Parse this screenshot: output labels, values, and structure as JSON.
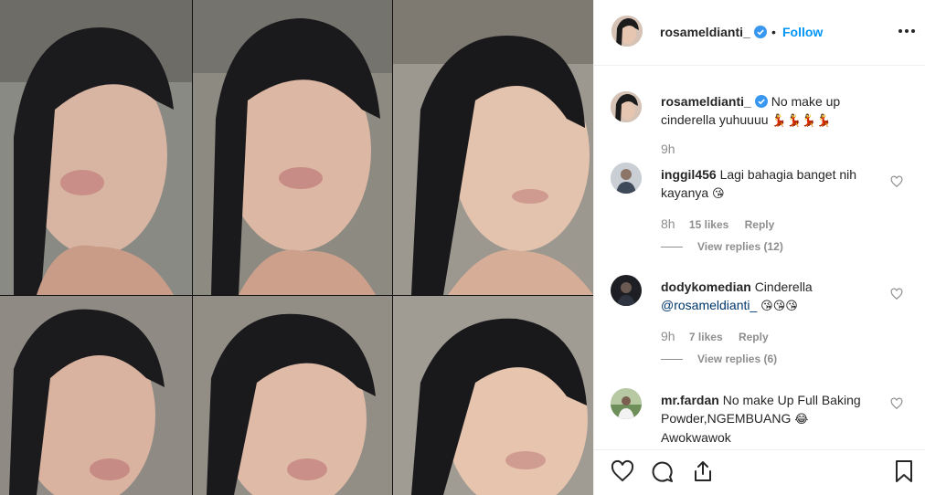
{
  "post": {
    "username": "rosameldianti_",
    "verified": true,
    "separator": "•",
    "follow_label": "Follow",
    "caption_text": "No make up cinderella yuhuuuu",
    "caption_emoji": "💃💃💃💃",
    "caption_time": "9h"
  },
  "comments": [
    {
      "username": "inggil456",
      "text": "Lagi bahagia banget nih kayanya",
      "emoji": "😘",
      "time": "8h",
      "likes": "15 likes",
      "reply": "Reply",
      "view_replies": "View replies (12)"
    },
    {
      "username": "dodykomedian",
      "text": "Cinderella",
      "mention": "@rosameldianti_",
      "emoji": "😘😘😘",
      "time": "9h",
      "likes": "7 likes",
      "reply": "Reply",
      "view_replies": "View replies (6)"
    },
    {
      "username": "mr.fardan",
      "text": "No make Up Full Baking Powder,NGEMBUANG",
      "emoji": "😂",
      "text2": "Awokwawok"
    }
  ],
  "icons": {
    "more": "more-options-icon",
    "like": "heart-icon",
    "comment": "comment-icon",
    "share": "share-icon",
    "save": "bookmark-icon"
  },
  "colors": {
    "link": "#0095f6",
    "muted": "#8e8e8e",
    "text": "#262626",
    "mention": "#00376b",
    "border": "#efefef"
  }
}
